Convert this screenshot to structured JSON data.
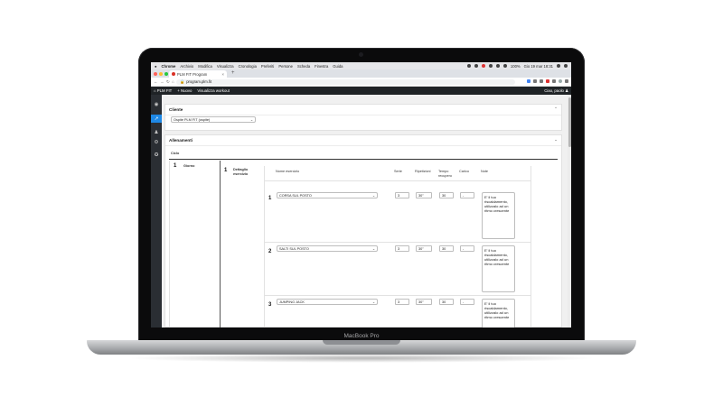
{
  "device": {
    "brand": "MacBook Pro"
  },
  "mac_menubar": {
    "items": [
      "Chrome",
      "Archivio",
      "Modifica",
      "Visualizza",
      "Cronologia",
      "Preferiti",
      "Persone",
      "Scheda",
      "Finestra",
      "Guida"
    ],
    "battery": "100%",
    "datetime": "Gio 19 mar  18:31"
  },
  "browser": {
    "tab_title": "PLM FIT Program",
    "url": "program.plm.fit",
    "new_tab": "+"
  },
  "app": {
    "brand": "PLM FIT",
    "nav_new": "Nuovo",
    "nav_workout": "Visualizza workout",
    "greeting": "Ciao, paolo"
  },
  "cliente": {
    "title": "Cliente",
    "selected": "Ospite PLM FIT (ospite)"
  },
  "allenamenti": {
    "title": "Allenamenti",
    "ciclo_label": "Ciclo",
    "giorno_number": "1",
    "giorno_label": "Giorno",
    "dettaglio_number": "1",
    "dettaglio_label": "Dettaglio esercizio",
    "columns": {
      "nome": "Nome esercizio",
      "serie": "Serie",
      "ripetizioni": "Ripetizioni",
      "recupero": "Tempo recupero",
      "carico": "Carico",
      "note": "Note"
    },
    "exercises": [
      {
        "n": "1",
        "name": "CORSA SUL POSTO",
        "serie": "3",
        "ripetizioni": "30\"",
        "recupero": "30",
        "carico": "-",
        "note": "E' il tuo riscaldamento, utilizzalo ad un ritmo crescente"
      },
      {
        "n": "2",
        "name": "SALTI SUL POSTO",
        "serie": "3",
        "ripetizioni": "30\"",
        "recupero": "30",
        "carico": "-",
        "note": "E' il tuo riscaldamento, utilizzalo ad un ritmo crescente"
      },
      {
        "n": "3",
        "name": "JUMPING JACK",
        "serie": "3",
        "ripetizioni": "30\"",
        "recupero": "30",
        "carico": "-",
        "note": "E' il tuo riscaldamento, utilizzalo ad un ritmo crescente"
      }
    ]
  }
}
